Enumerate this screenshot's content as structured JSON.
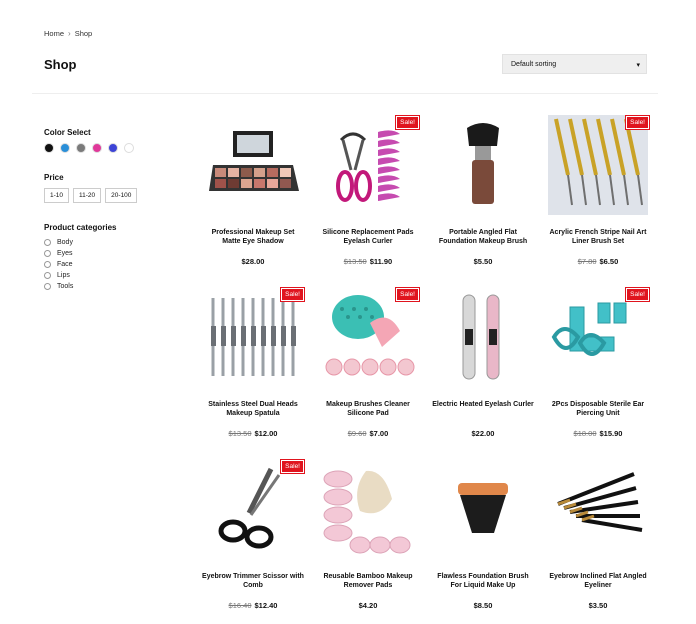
{
  "breadcrumb": {
    "home": "Home",
    "separator": "›",
    "current": "Shop"
  },
  "page": {
    "title": "Shop"
  },
  "sorting": {
    "selected": "Default sorting",
    "caret_icon": "chevron-down-icon"
  },
  "sidebar": {
    "color_title": "Color Select",
    "colors": [
      "#111111",
      "#2a8fd8",
      "#7a7a7a",
      "#e0389a",
      "#3d44d6",
      "#ffffff"
    ],
    "price_title": "Price",
    "prices": [
      "1-10",
      "11-20",
      "20-100"
    ],
    "categories_title": "Product categories",
    "categories": [
      "Body",
      "Eyes",
      "Face",
      "Lips",
      "Tools"
    ]
  },
  "products": [
    {
      "name": "Professional Makeup Set Matte Eye Shadow",
      "old_price": "",
      "price": "$28.00",
      "sale": false,
      "icon": "makeup-palette-icon"
    },
    {
      "name": "Silicone Replacement Pads Eyelash Curler",
      "old_price": "$13.50",
      "price": "$11.90",
      "sale": true,
      "icon": "eyelash-curler-icon"
    },
    {
      "name": "Portable Angled Flat Foundation Makeup Brush",
      "old_price": "",
      "price": "$5.50",
      "sale": false,
      "icon": "foundation-brush-icon"
    },
    {
      "name": "Acrylic French Stripe Nail Art Liner Brush Set",
      "old_price": "$7.80",
      "price": "$6.50",
      "sale": true,
      "icon": "nail-brush-set-icon"
    },
    {
      "name": "Stainless Steel Dual Heads Makeup Spatula",
      "old_price": "$13.50",
      "price": "$12.00",
      "sale": true,
      "icon": "spatula-set-icon"
    },
    {
      "name": "Makeup Brushes Cleaner Silicone Pad",
      "old_price": "$9.60",
      "price": "$7.00",
      "sale": true,
      "icon": "brush-cleaner-pad-icon"
    },
    {
      "name": "Electric Heated Eyelash Curler",
      "old_price": "",
      "price": "$22.00",
      "sale": false,
      "icon": "heated-curler-icon"
    },
    {
      "name": "2Pcs Disposable Sterile Ear Piercing Unit",
      "old_price": "$18.00",
      "price": "$15.90",
      "sale": true,
      "icon": "ear-piercing-gun-icon"
    },
    {
      "name": "Eyebrow Trimmer Scissor with Comb",
      "old_price": "$16.40",
      "price": "$12.40",
      "sale": true,
      "icon": "scissor-icon"
    },
    {
      "name": "Reusable Bamboo Makeup Remover Pads",
      "old_price": "",
      "price": "$4.20",
      "sale": false,
      "icon": "remover-pads-icon"
    },
    {
      "name": "Flawless Foundation Brush For Liquid Make Up",
      "old_price": "",
      "price": "$8.50",
      "sale": false,
      "icon": "flawless-brush-icon"
    },
    {
      "name": "Eyebrow Inclined Flat Angled Eyeliner",
      "old_price": "",
      "price": "$3.50",
      "sale": false,
      "icon": "eyeliner-brushes-icon"
    }
  ],
  "sale_label": "Sale!"
}
